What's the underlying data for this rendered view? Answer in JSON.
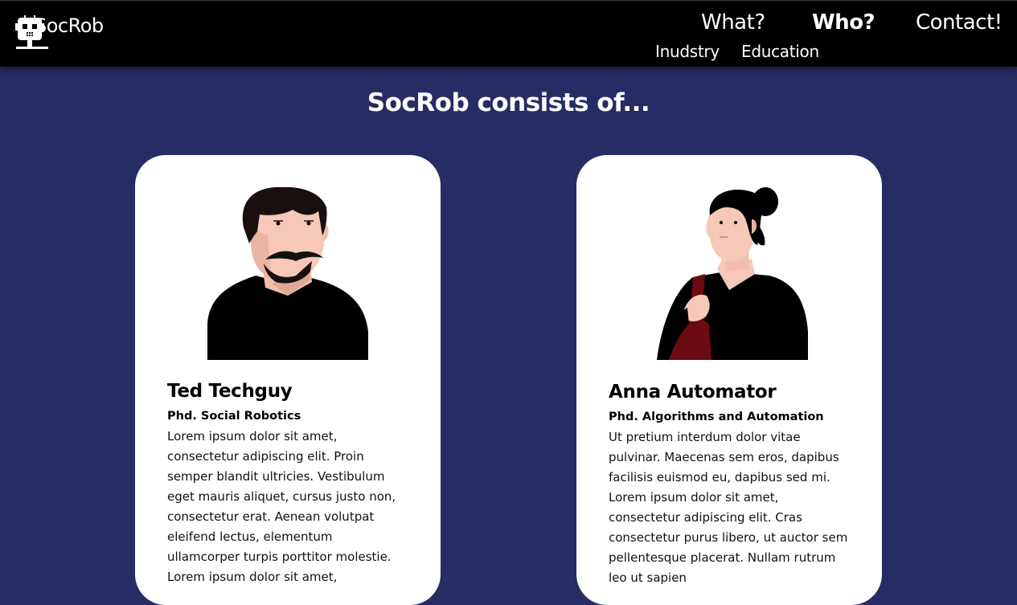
{
  "brand": {
    "name": "SocRob",
    "logo_icon": "robot-icon"
  },
  "nav": {
    "primary": [
      {
        "label": "What?",
        "active": false
      },
      {
        "label": "Who?",
        "active": true
      },
      {
        "label": "Contact!",
        "active": false
      }
    ],
    "secondary": [
      {
        "label": "Inudstry"
      },
      {
        "label": "Education"
      }
    ]
  },
  "section": {
    "title": "SocRob consists of..."
  },
  "colors": {
    "page_bg": "#282c64",
    "navbar_bg": "#000000",
    "card_bg": "#ffffff"
  },
  "people": [
    {
      "name": "Ted Techguy",
      "degree": "Phd. Social Robotics",
      "bio": "Lorem ipsum dolor sit amet, consectetur adipiscing elit. Proin semper blandit ultricies. Vestibulum eget mauris aliquet, cursus justo non, consectetur erat. Aenean volutpat eleifend lectus, elementum ullamcorper turpis porttitor molestie. Lorem ipsum dolor sit amet,",
      "avatar_icon": "male-portrait-illustration"
    },
    {
      "name": "Anna Automator",
      "degree": "Phd. Algorithms and Automation",
      "bio": "Ut pretium interdum dolor vitae pulvinar. Maecenas sem eros, dapibus facilisis euismod eu, dapibus sed mi. Lorem ipsum dolor sit amet, consectetur adipiscing elit. Cras consectetur purus libero, ut auctor sem pellentesque placerat. Nullam rutrum leo ut sapien",
      "avatar_icon": "female-portrait-illustration"
    }
  ]
}
